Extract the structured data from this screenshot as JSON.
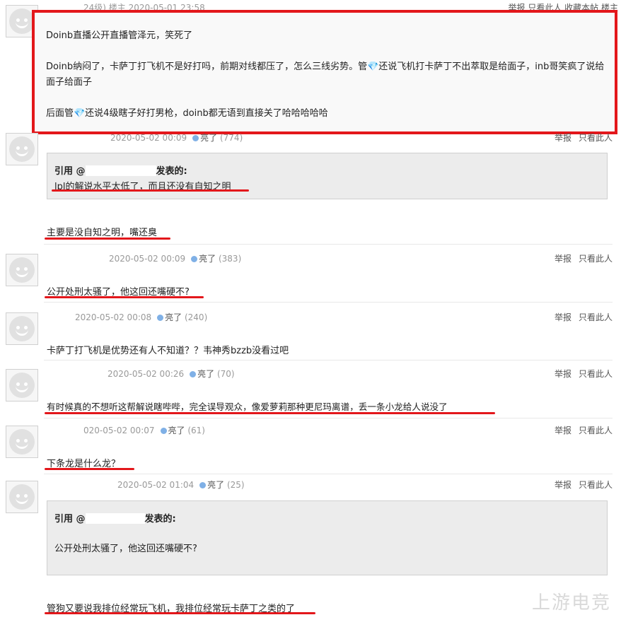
{
  "first_post": {
    "meta_partial": "24级) 楼主 2020-05-01 23:58",
    "actions_partial": "举报 只看此人 收藏本帖 楼主",
    "paragraphs": [
      "Doinb直播公开直播管泽元，笑死了",
      "Doinb纳闷了，卡萨丁打飞机不是好打吗，前期对线都压了，怎么三线劣势。管💎还说飞机打卡萨丁不出萃取是给面子，inb哥笑疯了说给面子给面子",
      "后面管💎还说4级瞎子好打男枪，doinb都无语到直接关了哈哈哈哈哈"
    ]
  },
  "common": {
    "liang_label": "亮了",
    "report_label": "举报",
    "only_label": "只看此人",
    "quote_prefix": "引用 @",
    "quote_suffix": "发表的:"
  },
  "replies": [
    {
      "meta_partial": "2020-05-02 00:09",
      "count": "(774)",
      "quote_text": "lpl的解说水平太低了，而且还没有自知之明",
      "text": "主要是没自知之明，嘴还臭"
    },
    {
      "date": "2020-05-02 00:09",
      "count": "(383)",
      "text": "公开处刑太骚了，他这回还嘴硬不?"
    },
    {
      "date": "2020-05-02 00:08",
      "count": "(240)",
      "text": "卡萨丁打飞机是优势还有人不知道？？韦神秀bzzb没看过吧"
    },
    {
      "date": "2020-05-02 00:26",
      "count": "(70)",
      "text": "有时候真的不想听这帮解说瞎哔哔，完全误导观众，像爱萝莉那种更尼玛离谱，丢一条小龙给人说没了"
    },
    {
      "date": "020-05-02 00:07",
      "count": "(61)",
      "text": "下条龙是什么龙？"
    },
    {
      "date": "2020-05-02 01:04",
      "count": "(25)",
      "quote_text": "公开处刑太骚了，他这回还嘴硬不?",
      "text": "管狗又要说我排位经常玩飞机，我排位经常玩卡萨丁之类的了"
    }
  ],
  "watermark": "上游电竞"
}
